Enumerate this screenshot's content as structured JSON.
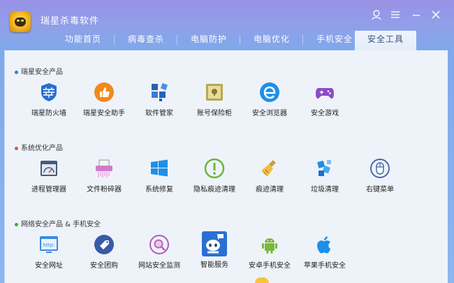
{
  "app": {
    "title": "瑞星杀毒软件"
  },
  "tabs": [
    {
      "label": "功能首页",
      "active": false
    },
    {
      "label": "病毒查杀",
      "active": false
    },
    {
      "label": "电脑防护",
      "active": false
    },
    {
      "label": "电脑优化",
      "active": false
    },
    {
      "label": "手机安全",
      "active": false
    },
    {
      "label": "安全工具",
      "active": true
    }
  ],
  "sections": [
    {
      "title": "瑞星安全产品",
      "dot_color": "#2f7fe0",
      "items": [
        {
          "label": "瑞星防火墙",
          "icon": "firewall-icon"
        },
        {
          "label": "瑞星安全助手",
          "icon": "thumbs-up-icon"
        },
        {
          "label": "软件管家",
          "icon": "software-blocks-icon"
        },
        {
          "label": "账号保险柜",
          "icon": "safe-icon"
        },
        {
          "label": "安全浏览器",
          "icon": "browser-e-icon"
        },
        {
          "label": "安全游戏",
          "icon": "gamepad-icon"
        }
      ]
    },
    {
      "title": "系统优化产品",
      "dot_color": "#e0503a",
      "items": [
        {
          "label": "进程管理器",
          "icon": "process-window-icon"
        },
        {
          "label": "文件粉碎器",
          "icon": "shredder-icon"
        },
        {
          "label": "系统修复",
          "icon": "windows-icon"
        },
        {
          "label": "隐私痕迹清理",
          "icon": "exclamation-icon"
        },
        {
          "label": "痕迹清理",
          "icon": "broom-icon"
        },
        {
          "label": "垃圾清理",
          "icon": "trash-blocks-icon"
        },
        {
          "label": "右键菜单",
          "icon": "mouse-icon"
        }
      ]
    },
    {
      "title": "网络安全产品 & 手机安全",
      "dot_color": "#3aaa3a",
      "items": [
        {
          "label": "安全网址",
          "icon": "http-icon"
        },
        {
          "label": "安全团购",
          "icon": "tag-icon"
        },
        {
          "label": "网站安全监测",
          "icon": "magnifier-icon"
        },
        {
          "label": "智能服务",
          "icon": "robot-icon"
        },
        {
          "label": "安卓手机安全",
          "icon": "android-icon"
        },
        {
          "label": "苹果手机安全",
          "icon": "apple-icon"
        }
      ]
    }
  ],
  "colors": {
    "title_gradient_top": "#9a92e6",
    "content_bg": "#eef3fa",
    "accent_blue": "#2f7fe0"
  }
}
